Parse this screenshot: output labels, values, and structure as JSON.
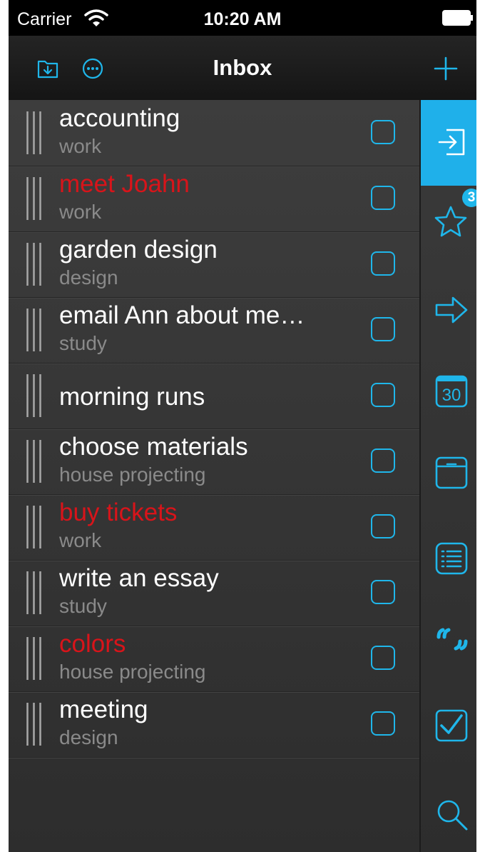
{
  "status_bar": {
    "carrier": "Carrier",
    "time": "10:20 AM"
  },
  "nav": {
    "title": "Inbox",
    "left_icons": [
      "import-folder-icon",
      "more-circle-icon"
    ],
    "right_icon": "plus-icon"
  },
  "tasks": [
    {
      "title": "accounting",
      "category": "work",
      "red": false
    },
    {
      "title": "meet Joahn",
      "category": "work",
      "red": true
    },
    {
      "title": "garden design",
      "category": "design",
      "red": false
    },
    {
      "title": "email Ann about me…",
      "category": "study",
      "red": false
    },
    {
      "title": "morning runs",
      "category": "",
      "red": false
    },
    {
      "title": "choose materials",
      "category": "house projecting",
      "red": false
    },
    {
      "title": "buy tickets",
      "category": "work",
      "red": true
    },
    {
      "title": "write an essay",
      "category": "study",
      "red": false
    },
    {
      "title": "colors",
      "category": "house projecting",
      "red": true
    },
    {
      "title": "meeting",
      "category": "design",
      "red": false
    }
  ],
  "sidebar": {
    "items": [
      {
        "icon": "inbox-icon",
        "active": true
      },
      {
        "icon": "star-icon",
        "badge": "3"
      },
      {
        "icon": "arrow-right-icon"
      },
      {
        "icon": "calendar-icon",
        "label": "30"
      },
      {
        "icon": "archive-box-icon"
      },
      {
        "icon": "list-icon"
      },
      {
        "icon": "quote-icon"
      },
      {
        "icon": "checkbox-checked-icon"
      },
      {
        "icon": "search-icon"
      }
    ]
  },
  "colors": {
    "accent": "#1fb6ea",
    "red_task": "#d8141a",
    "category_text": "#8a8a8a",
    "background": "#2f2f2f"
  }
}
